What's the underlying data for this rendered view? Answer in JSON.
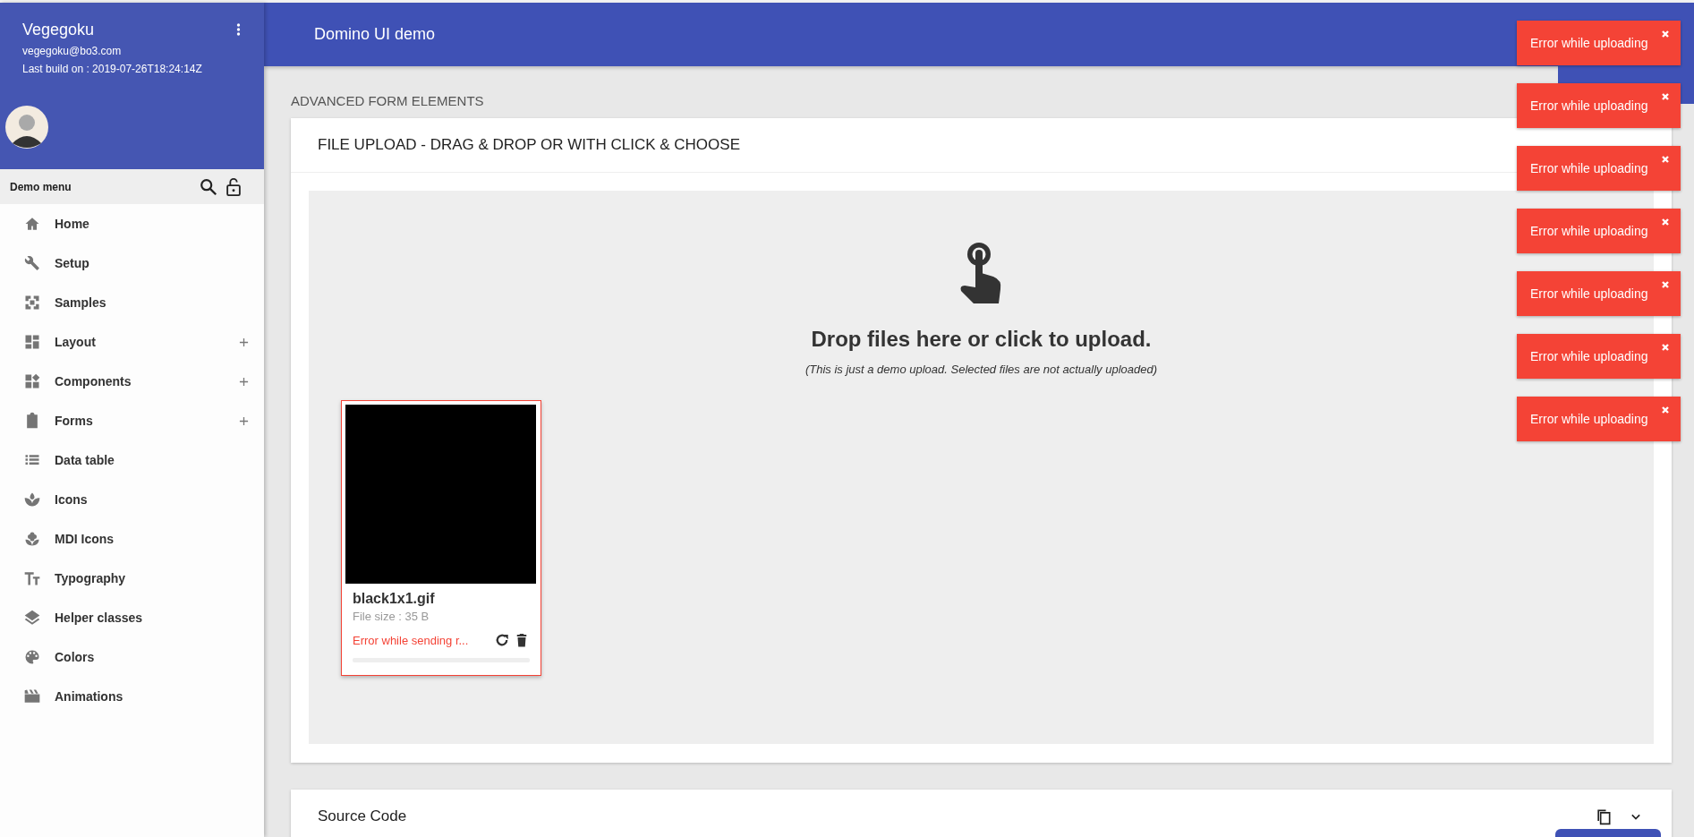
{
  "sidebar": {
    "user": {
      "name": "Vegegoku",
      "email": "vegegoku@bo3.com",
      "build": "Last build on : 2019-07-26T18:24:14Z"
    },
    "menu_title": "Demo menu",
    "items": [
      {
        "label": "Home",
        "expandable": false
      },
      {
        "label": "Setup",
        "expandable": false
      },
      {
        "label": "Samples",
        "expandable": false
      },
      {
        "label": "Layout",
        "expandable": true
      },
      {
        "label": "Components",
        "expandable": true
      },
      {
        "label": "Forms",
        "expandable": true
      },
      {
        "label": "Data table",
        "expandable": false
      },
      {
        "label": "Icons",
        "expandable": false
      },
      {
        "label": "MDI Icons",
        "expandable": false
      },
      {
        "label": "Typography",
        "expandable": false
      },
      {
        "label": "Helper classes",
        "expandable": false
      },
      {
        "label": "Colors",
        "expandable": false
      },
      {
        "label": "Animations",
        "expandable": false
      }
    ]
  },
  "top_bar": {
    "title": "Domino UI demo"
  },
  "section_title": "ADVANCED FORM ELEMENTS",
  "upload_card": {
    "title": "FILE UPLOAD - DRAG & DROP OR WITH CLICK & CHOOSE",
    "drop_title": "Drop files here or click to upload.",
    "drop_note": "(This is just a demo upload. Selected files are not actually uploaded)",
    "files": [
      {
        "kind": "picture",
        "name": "black1x1.gif",
        "size": "File size : 35 B",
        "message": "Error while sending r...",
        "error": true,
        "level": 0
      }
    ]
  },
  "source_card": {
    "title": "Source Code"
  },
  "toasts": [
    {
      "text": "Error while uploading"
    },
    {
      "text": "Error while uploading"
    },
    {
      "text": "Error while uploading"
    },
    {
      "text": "Error while uploading"
    },
    {
      "text": "Error while uploading"
    },
    {
      "text": "Error while uploading"
    },
    {
      "text": "Error while uploading"
    }
  ]
}
